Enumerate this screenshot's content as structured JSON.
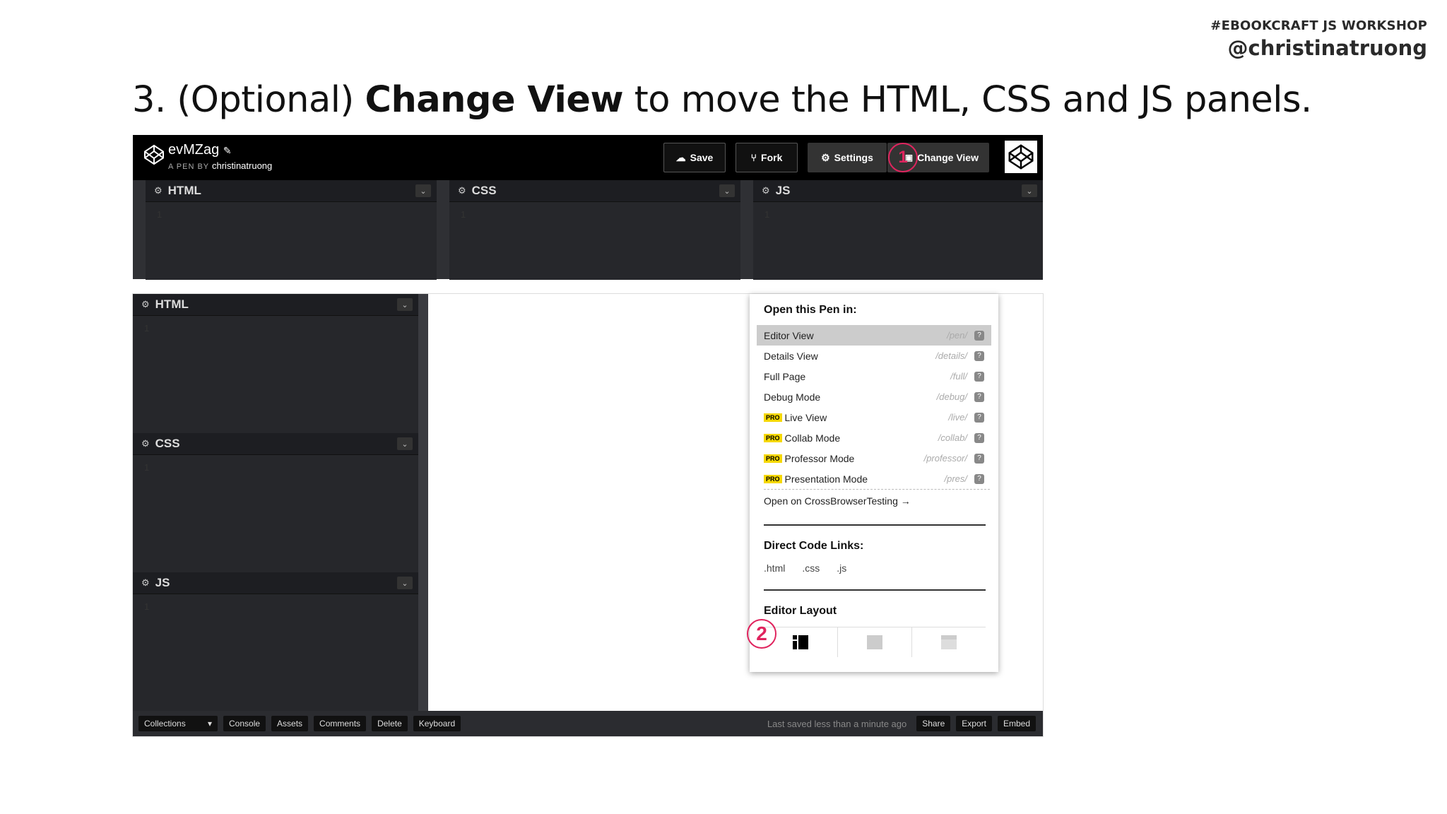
{
  "slide": {
    "tag": "#EBOOKCRAFT JS WORKSHOP",
    "author": "@christinatruong",
    "title_prefix": "3. (Optional) ",
    "title_bold": "Change View",
    "title_suffix": " to move the HTML, CSS and JS panels."
  },
  "codepen": {
    "pen_title": "evMZag",
    "pen_by_label": "A PEN BY",
    "pen_author": "christinatruong",
    "buttons": {
      "save": "Save",
      "fork": "Fork",
      "settings": "Settings",
      "change_view": "Change View"
    },
    "editors": [
      {
        "name": "HTML",
        "line": "1"
      },
      {
        "name": "CSS",
        "line": "1"
      },
      {
        "name": "JS",
        "line": "1"
      }
    ]
  },
  "dropdown": {
    "title": "Open this Pen in:",
    "items": [
      {
        "label": "Editor View",
        "path": "/pen/",
        "pro": false
      },
      {
        "label": "Details View",
        "path": "/details/",
        "pro": false
      },
      {
        "label": "Full Page",
        "path": "/full/",
        "pro": false
      },
      {
        "label": "Debug Mode",
        "path": "/debug/",
        "pro": false
      },
      {
        "label": "Live View",
        "path": "/live/",
        "pro": true
      },
      {
        "label": "Collab Mode",
        "path": "/collab/",
        "pro": true
      },
      {
        "label": "Professor Mode",
        "path": "/professor/",
        "pro": true
      },
      {
        "label": "Presentation Mode",
        "path": "/pres/",
        "pro": true
      }
    ],
    "pro_badge": "PRO",
    "help_glyph": "?",
    "crossbrowser": "Open on CrossBrowserTesting →",
    "direct_links_title": "Direct Code Links:",
    "direct_links": [
      ".html",
      ".css",
      ".js"
    ],
    "layout_title": "Editor Layout"
  },
  "footer": {
    "buttons": [
      "Collections",
      "Console",
      "Assets",
      "Comments",
      "Delete",
      "Keyboard"
    ],
    "collections_caret": "▾",
    "status": "Last saved less than a minute ago",
    "right_buttons": [
      "Share",
      "Export",
      "Embed"
    ]
  },
  "callouts": {
    "one": "1",
    "two": "2"
  },
  "colors": {
    "callout": "#e0245e",
    "pro": "#f6d800",
    "editor_bg": "#1d1e22"
  }
}
